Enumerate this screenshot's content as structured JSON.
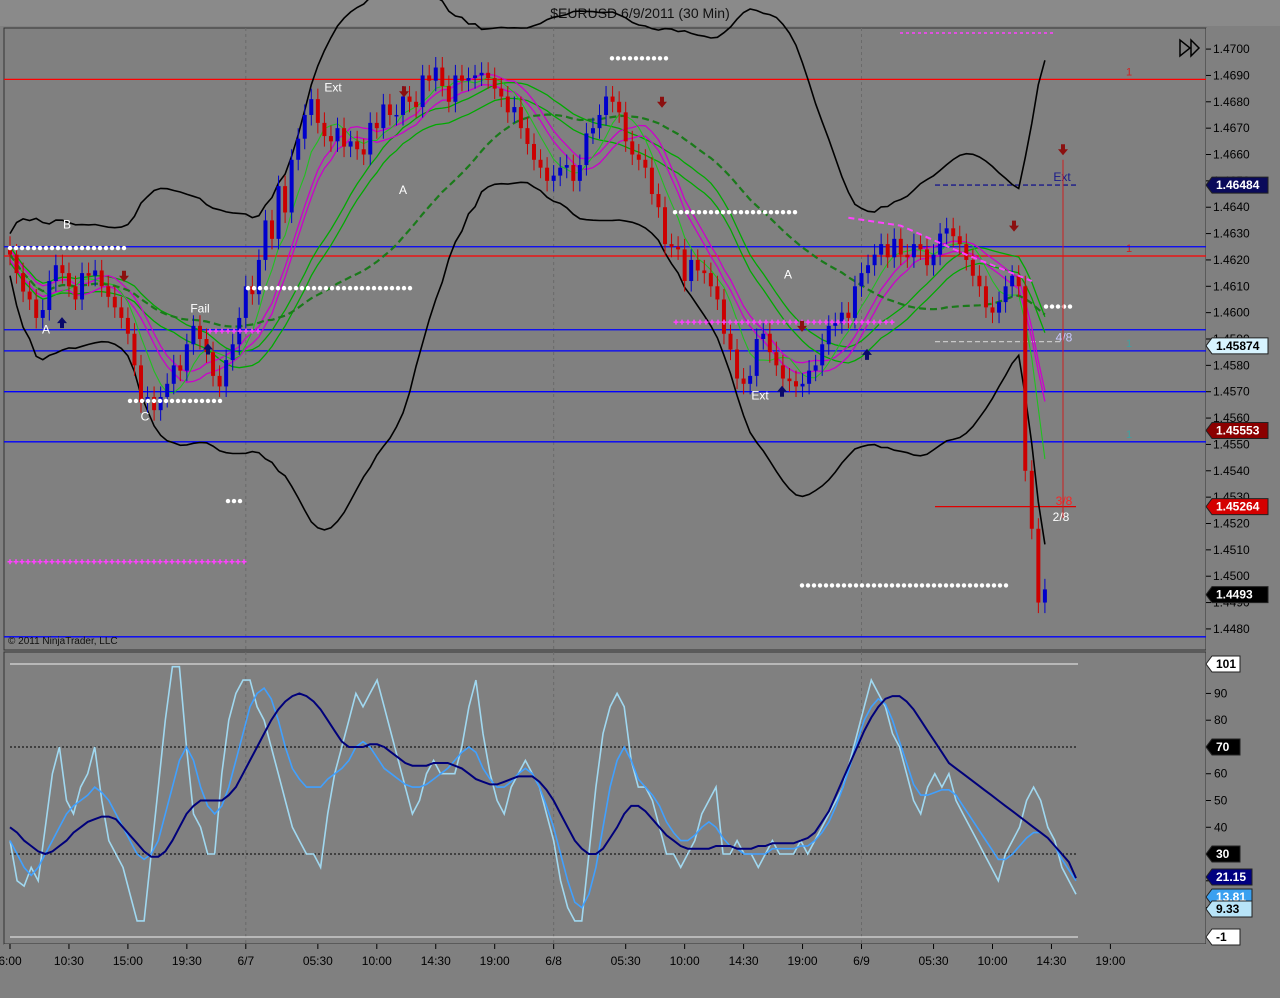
{
  "window": {
    "title": "$EURUSD  6/9/2011 (30 Min)"
  },
  "copyright": "© 2011 NinjaTrader, LLC",
  "colors": {
    "bg": "#808080",
    "up": "#0000cc",
    "down": "#cc0000",
    "ma_green": "#00aa00",
    "ma_magenta": "#cc00cc",
    "envelope": "#000000",
    "level_red": "#ff0000",
    "level_blue": "#0000ff",
    "stoch_light": "#a0d8f0",
    "stoch_mid": "#40a0ff",
    "stoch_dark": "#00007a"
  },
  "chart_data": [
    {
      "type": "candlestick",
      "title": "$EURUSD  6/9/2011 (30 Min)",
      "ylim": [
        1.4472,
        1.4708
      ],
      "y_ticks": [
        "1.4700",
        "1.4690",
        "1.4680",
        "1.4670",
        "1.4660",
        "1.4650",
        "1.4640",
        "1.4630",
        "1.4620",
        "1.4610",
        "1.4600",
        "1.4590",
        "1.4580",
        "1.4570",
        "1.4560",
        "1.4550",
        "1.4540",
        "1.4530",
        "1.4520",
        "1.4510",
        "1.4500",
        "1.4490",
        "1.4480"
      ],
      "x_ticks": [
        "6:00",
        "10:30",
        "15:00",
        "19:30",
        "6/7",
        "05:30",
        "10:00",
        "14:30",
        "19:00",
        "6/8",
        "05:30",
        "10:00",
        "14:30",
        "19:00",
        "6/9",
        "05:30",
        "10:00",
        "14:30",
        "19:00"
      ],
      "x_tick_index": [
        0,
        9,
        18,
        27,
        36,
        47,
        56,
        65,
        74,
        83,
        94,
        103,
        112,
        121,
        130,
        141,
        150,
        159,
        168
      ],
      "close": [
        1.4622,
        1.4615,
        1.4608,
        1.4605,
        1.4598,
        1.4601,
        1.4612,
        1.4618,
        1.4615,
        1.461,
        1.4605,
        1.4615,
        1.4614,
        1.4616,
        1.461,
        1.4606,
        1.4602,
        1.4598,
        1.4592,
        1.458,
        1.4566,
        1.4568,
        1.4563,
        1.4568,
        1.4573,
        1.458,
        1.4578,
        1.4588,
        1.4595,
        1.459,
        1.4585,
        1.4576,
        1.4572,
        1.4582,
        1.4588,
        1.4598,
        1.461,
        1.4607,
        1.462,
        1.4635,
        1.4628,
        1.4648,
        1.4638,
        1.4658,
        1.4666,
        1.4675,
        1.4681,
        1.4672,
        1.4667,
        1.4665,
        1.467,
        1.4663,
        1.4665,
        1.4662,
        1.466,
        1.4672,
        1.467,
        1.4679,
        1.4675,
        1.4675,
        1.4682,
        1.468,
        1.4678,
        1.469,
        1.4688,
        1.4693,
        1.4686,
        1.468,
        1.469,
        1.4688,
        1.4689,
        1.469,
        1.4691,
        1.4689,
        1.4685,
        1.4682,
        1.4676,
        1.4678,
        1.467,
        1.4664,
        1.4658,
        1.4655,
        1.465,
        1.4652,
        1.4655,
        1.4656,
        1.465,
        1.4656,
        1.4668,
        1.467,
        1.4675,
        1.4682,
        1.468,
        1.4676,
        1.4665,
        1.466,
        1.4658,
        1.4655,
        1.4645,
        1.464,
        1.4626,
        1.4625,
        1.4624,
        1.4612,
        1.462,
        1.4616,
        1.4615,
        1.461,
        1.4605,
        1.4592,
        1.4586,
        1.4575,
        1.4573,
        1.4576,
        1.459,
        1.4592,
        1.4585,
        1.458,
        1.4575,
        1.4574,
        1.4572,
        1.4573,
        1.4578,
        1.458,
        1.4588,
        1.4595,
        1.4596,
        1.46,
        1.4598,
        1.461,
        1.4615,
        1.4618,
        1.4622,
        1.4626,
        1.4621,
        1.4628,
        1.4622,
        1.4621,
        1.4626,
        1.4624,
        1.4618,
        1.4622,
        1.463,
        1.4632,
        1.4629,
        1.4626,
        1.462,
        1.4614,
        1.461,
        1.4602,
        1.46,
        1.4604,
        1.461,
        1.4614,
        1.461,
        1.454,
        1.4518,
        1.449,
        1.4495
      ],
      "open_offset_hint": "open ≈ previous close",
      "bar_count": 157,
      "price_labels": [
        {
          "value": "1.46484",
          "color": "#0a0a5a"
        },
        {
          "value": "1.45874",
          "color": "#d8f4ff"
        },
        {
          "value": "1.45553",
          "color": "#8b0000"
        },
        {
          "value": "1.45264",
          "color": "#d40000"
        },
        {
          "value": "1.4493",
          "color": "#000000"
        }
      ],
      "horizontal_levels": [
        {
          "price": 1.46885,
          "color": "#ff0000",
          "label": "1"
        },
        {
          "price": 1.46215,
          "color": "#ff0000",
          "label": "1"
        },
        {
          "price": 1.4625,
          "color": "#0000ff",
          "label": ""
        },
        {
          "price": 1.45935,
          "color": "#0000ff",
          "label": ""
        },
        {
          "price": 1.45855,
          "color": "#0000ff",
          "label": "1"
        },
        {
          "price": 1.457,
          "color": "#0000ff",
          "label": ""
        },
        {
          "price": 1.4551,
          "color": "#0000ff",
          "label": "1"
        },
        {
          "price": 1.4477,
          "color": "#0000ff",
          "label": ""
        }
      ],
      "annotations": [
        "B",
        "A",
        "C",
        "Fail",
        "Ext",
        "A",
        "A",
        "Ext",
        "Ext",
        "4/8",
        "3/8",
        "2/8"
      ],
      "legend": "none"
    },
    {
      "type": "line",
      "title": "",
      "ylim": [
        -1,
        101
      ],
      "y_ticks": [
        101,
        90,
        80,
        70,
        60,
        50,
        40,
        30,
        20,
        10,
        -1
      ],
      "threshold_levels": [
        101,
        70,
        30,
        -1
      ],
      "current_values": [
        "21.15",
        "13.81",
        "9.33"
      ],
      "series": [
        {
          "name": "",
          "color": "#a0d8f0",
          "values": [
            35,
            20,
            18,
            25,
            20,
            40,
            60,
            70,
            50,
            45,
            55,
            60,
            70,
            50,
            35,
            30,
            25,
            15,
            5,
            5,
            30,
            55,
            80,
            100,
            100,
            70,
            45,
            40,
            30,
            30,
            60,
            80,
            90,
            95,
            95,
            85,
            80,
            70,
            60,
            50,
            40,
            35,
            30,
            30,
            25,
            45,
            60,
            70,
            80,
            90,
            85,
            90,
            95,
            85,
            75,
            65,
            55,
            45,
            50,
            60,
            65,
            60,
            60,
            60,
            70,
            85,
            95,
            75,
            60,
            50,
            45,
            55,
            60,
            65,
            60,
            55,
            45,
            35,
            20,
            10,
            5,
            5,
            30,
            55,
            75,
            85,
            90,
            85,
            65,
            55,
            55,
            50,
            40,
            30,
            30,
            25,
            30,
            35,
            45,
            50,
            55,
            30,
            30,
            35,
            30,
            30,
            25,
            30,
            35,
            30,
            30,
            30,
            35,
            30,
            35,
            40,
            45,
            50,
            55,
            65,
            75,
            85,
            95,
            90,
            85,
            75,
            70,
            60,
            50,
            45,
            55,
            60,
            55,
            60,
            50,
            45,
            40,
            35,
            30,
            25,
            20,
            30,
            35,
            40,
            50,
            55,
            50,
            40,
            35,
            25,
            20,
            15
          ]
        },
        {
          "name": "",
          "color": "#40a0ff",
          "values": [
            35,
            30,
            25,
            22,
            25,
            30,
            35,
            40,
            45,
            48,
            50,
            52,
            55,
            53,
            50,
            45,
            40,
            35,
            30,
            28,
            30,
            35,
            45,
            55,
            65,
            70,
            65,
            55,
            48,
            45,
            48,
            55,
            65,
            75,
            85,
            90,
            92,
            88,
            80,
            70,
            62,
            58,
            55,
            55,
            55,
            58,
            60,
            62,
            65,
            70,
            72,
            70,
            66,
            62,
            60,
            58,
            56,
            55,
            55,
            56,
            58,
            60,
            62,
            65,
            68,
            70,
            68,
            62,
            58,
            55,
            55,
            57,
            60,
            62,
            60,
            55,
            48,
            40,
            30,
            20,
            12,
            10,
            15,
            25,
            40,
            55,
            65,
            70,
            65,
            58,
            55,
            52,
            48,
            42,
            38,
            35,
            35,
            37,
            40,
            42,
            40,
            36,
            33,
            32,
            30,
            30,
            30,
            30,
            32,
            32,
            32,
            32,
            33,
            33,
            35,
            38,
            42,
            48,
            55,
            63,
            72,
            80,
            85,
            88,
            86,
            80,
            72,
            64,
            56,
            52,
            52,
            53,
            54,
            54,
            52,
            48,
            44,
            40,
            36,
            32,
            28,
            28,
            30,
            33,
            36,
            38,
            38,
            36,
            33,
            28,
            24,
            20
          ]
        },
        {
          "name": "",
          "color": "#00007a",
          "values": [
            40,
            38,
            35,
            33,
            31,
            30,
            31,
            33,
            35,
            38,
            40,
            42,
            43,
            44,
            44,
            43,
            40,
            37,
            34,
            31,
            29,
            29,
            31,
            35,
            40,
            45,
            48,
            50,
            50,
            50,
            50,
            52,
            55,
            60,
            65,
            70,
            75,
            80,
            84,
            87,
            89,
            90,
            89,
            87,
            84,
            80,
            76,
            72,
            70,
            70,
            70,
            71,
            71,
            70,
            68,
            66,
            64,
            63,
            63,
            63,
            64,
            64,
            64,
            63,
            62,
            60,
            58,
            57,
            56,
            56,
            57,
            58,
            59,
            59,
            59,
            57,
            54,
            50,
            45,
            40,
            35,
            32,
            30,
            30,
            32,
            36,
            40,
            45,
            48,
            48,
            46,
            43,
            40,
            37,
            35,
            33,
            32,
            32,
            32,
            32,
            33,
            33,
            33,
            32,
            32,
            32,
            33,
            33,
            34,
            34,
            34,
            34,
            35,
            36,
            38,
            42,
            46,
            52,
            58,
            64,
            70,
            76,
            81,
            85,
            88,
            89,
            89,
            87,
            84,
            80,
            76,
            72,
            68,
            64,
            62,
            60,
            58,
            56,
            54,
            52,
            50,
            48,
            46,
            44,
            42,
            40,
            38,
            36,
            33,
            30,
            27,
            21
          ]
        }
      ],
      "legend": "none"
    }
  ]
}
